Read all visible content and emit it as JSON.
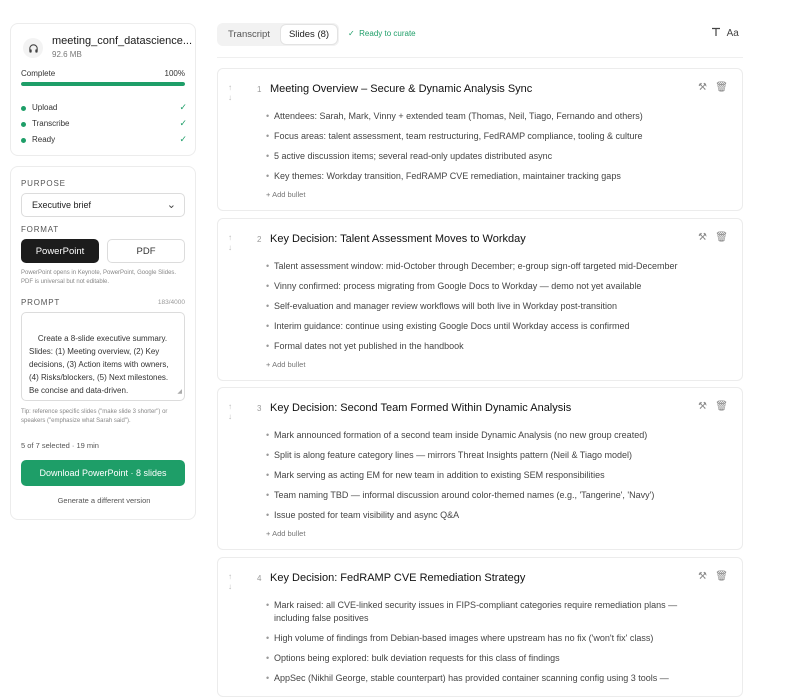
{
  "file": {
    "name": "meeting_conf_datascience...",
    "size": "92.6 MB",
    "status_label": "Complete",
    "progress_text": "100%",
    "progress": 1.0,
    "steps": [
      {
        "label": "Upload",
        "check": "✓"
      },
      {
        "label": "Transcribe",
        "check": "✓"
      },
      {
        "label": "Ready",
        "check": "✓"
      }
    ]
  },
  "settings": {
    "purpose_label": "PURPOSE",
    "purpose_value": "Executive brief",
    "format_label": "FORMAT",
    "format_powerpoint": "PowerPoint",
    "format_pdf": "PDF",
    "format_note": "PowerPoint opens in Keynote, PowerPoint, Google Slides. PDF is universal but not editable.",
    "prompt_label": "PROMPT",
    "prompt_count": "183/4000",
    "prompt_text": "Create a 8-slide executive summary. Slides: (1) Meeting overview, (2) Key decisions, (3) Action items with owners, (4) Risks/blockers, (5) Next milestones. Be concise and data-driven.",
    "tip": "Tip: reference specific slides (\"make slide 3 shorter\") or speakers (\"emphasize what Sarah said\").",
    "selection_meta": "5 of 7 selected · 19 min",
    "download_label": "Download PowerPoint · 8 slides",
    "generate_label": "Generate a different version"
  },
  "topbar": {
    "tab_transcript": "Transcript",
    "tab_slides": "Slides (8)",
    "ready_text": "Ready to curate",
    "font_tool": "Aa"
  },
  "add_bullet_label": "Add bullet",
  "slides": [
    {
      "num": "1",
      "title": "Meeting Overview – Secure & Dynamic Analysis Sync",
      "bullets": [
        "Attendees: Sarah, Mark, Vinny + extended team (Thomas, Neil, Tiago, Fernando and others)",
        "Focus areas: talent assessment, team restructuring, FedRAMP compliance, tooling & culture",
        "5 active discussion items; several read-only updates distributed async",
        "Key themes: Workday transition, FedRAMP CVE remediation, maintainer tracking gaps"
      ]
    },
    {
      "num": "2",
      "title": "Key Decision: Talent Assessment Moves to Workday",
      "bullets": [
        "Talent assessment window: mid-October through December; e-group sign-off targeted mid-December",
        "Vinny confirmed: process migrating from Google Docs to Workday — demo not yet available",
        "Self-evaluation and manager review workflows will both live in Workday post-transition",
        "Interim guidance: continue using existing Google Docs until Workday access is confirmed",
        "Formal dates not yet published in the handbook"
      ]
    },
    {
      "num": "3",
      "title": "Key Decision: Second Team Formed Within Dynamic Analysis",
      "bullets": [
        "Mark announced formation of a second team inside Dynamic Analysis (no new group created)",
        "Split is along feature category lines — mirrors Threat Insights pattern (Neil & Tiago model)",
        "Mark serving as acting EM for new team in addition to existing SEM responsibilities",
        "Team naming TBD — informal discussion around color-themed names (e.g., 'Tangerine', 'Navy')",
        "Issue posted for team visibility and async Q&A"
      ]
    },
    {
      "num": "4",
      "title": "Key Decision: FedRAMP CVE Remediation Strategy",
      "bullets": [
        "Mark raised: all CVE-linked security issues in FIPS-compliant categories require remediation plans — including false positives",
        "High volume of findings from Debian-based images where upstream has no fix ('won't fix' class)",
        "Options being explored: bulk deviation requests for this class of findings",
        "AppSec (Nikhil George, stable counterpart) has provided container scanning config using 3 tools —"
      ]
    }
  ]
}
